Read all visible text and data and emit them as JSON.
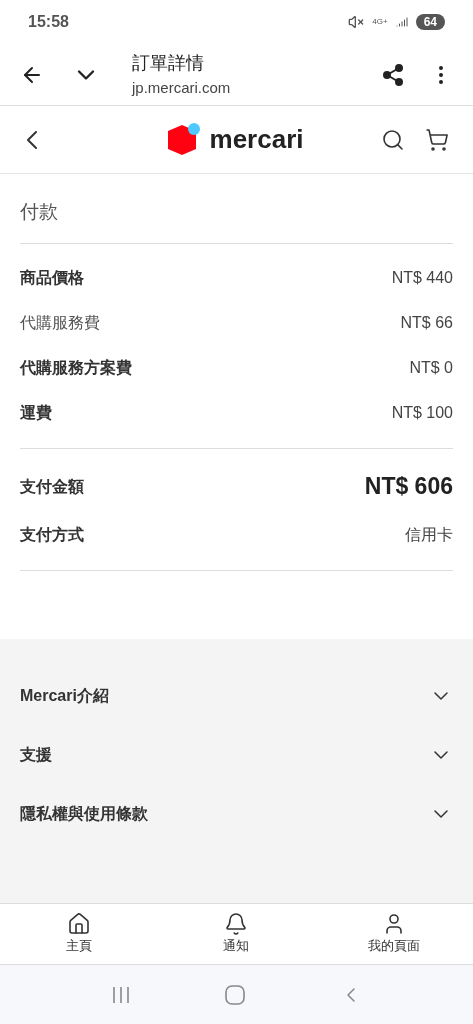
{
  "status_bar": {
    "time": "15:58",
    "network": "4G+",
    "battery": "64"
  },
  "browser_bar": {
    "title": "訂單詳情",
    "url": "jp.mercari.com"
  },
  "header": {
    "logo_text": "mercari"
  },
  "section": {
    "title": "付款",
    "groups": [
      [
        {
          "label": "商品價格",
          "value": "NT$ 440",
          "bold": true,
          "kind": "line"
        },
        {
          "label": "代購服務費",
          "value": "NT$ 66",
          "bold": false,
          "kind": "line"
        },
        {
          "label": "代購服務方案費",
          "value": "NT$ 0",
          "bold": true,
          "kind": "line"
        },
        {
          "label": "運費",
          "value": "NT$ 100",
          "bold": true,
          "kind": "line"
        }
      ],
      [
        {
          "label": "支付金額",
          "value": "NT$ 606",
          "bold": true,
          "kind": "total"
        },
        {
          "label": "支付方式",
          "value": "信用卡",
          "bold": true,
          "kind": "line"
        }
      ]
    ]
  },
  "footer_links": [
    {
      "label": "Mercari介紹",
      "expanded": false
    },
    {
      "label": "支援",
      "expanded": false
    },
    {
      "label": "隱私權與使用條款",
      "expanded": false
    }
  ],
  "bottom_nav": [
    {
      "label": "主頁"
    },
    {
      "label": "通知"
    },
    {
      "label": "我的頁面"
    }
  ]
}
